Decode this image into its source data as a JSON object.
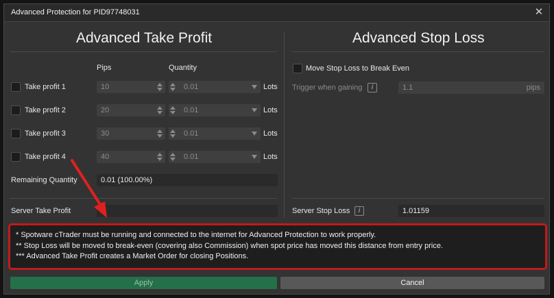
{
  "window": {
    "title": "Advanced Protection for PID97748031",
    "close_icon": "close-icon"
  },
  "take_profit": {
    "heading": "Advanced Take Profit",
    "col_pips": "Pips",
    "col_quantity": "Quantity",
    "rows": [
      {
        "label": "Take profit 1",
        "pips": "10",
        "quantity": "0.01",
        "unit": "Lots"
      },
      {
        "label": "Take profit 2",
        "pips": "20",
        "quantity": "0.01",
        "unit": "Lots"
      },
      {
        "label": "Take profit 3",
        "pips": "30",
        "quantity": "0.01",
        "unit": "Lots"
      },
      {
        "label": "Take profit 4",
        "pips": "40",
        "quantity": "0.01",
        "unit": "Lots"
      }
    ],
    "remaining_label": "Remaining Quantity",
    "remaining_value": "0.01 (100.00%)",
    "server_label": "Server Take Profit",
    "server_value": "-"
  },
  "stop_loss": {
    "heading": "Advanced Stop Loss",
    "break_even_label": "Move Stop Loss to Break Even",
    "trigger_label": "Trigger when gaining",
    "trigger_value": "1.1",
    "trigger_unit": "pips",
    "server_label": "Server Stop Loss",
    "server_value": "1.01159"
  },
  "notes": [
    "* Spotware cTrader must be running and connected to the internet for Advanced Protection to work properly.",
    "** Stop Loss will be moved to break-even (covering also Commission) when spot price has moved this distance from entry price.",
    "*** Advanced Take Profit creates a Market Order for closing Positions."
  ],
  "buttons": {
    "apply": "Apply",
    "cancel": "Cancel"
  },
  "info_glyph": "i",
  "colors": {
    "apply": "#24704a",
    "highlight": "#c21a1a",
    "arrow": "#e02020"
  }
}
